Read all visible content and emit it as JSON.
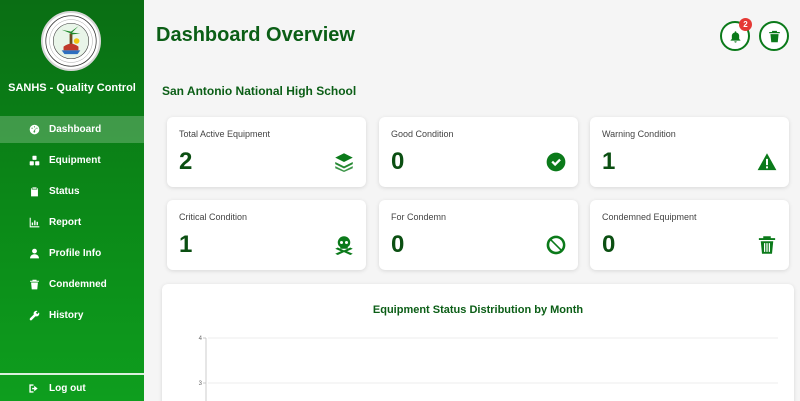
{
  "sidebar": {
    "logo": {
      "name": "sanhs-seal",
      "text": "SAN ANTONIO NATIONAL HIGH SCHOOL"
    },
    "brand": "SANHS - Quality Control",
    "items": [
      {
        "label": "Dashboard",
        "icon": "dashboard-icon",
        "active": true
      },
      {
        "label": "Equipment",
        "icon": "equipment-icon",
        "active": false
      },
      {
        "label": "Status",
        "icon": "clipboard-icon",
        "active": false
      },
      {
        "label": "Report",
        "icon": "chart-icon",
        "active": false
      },
      {
        "label": "Profile Info",
        "icon": "user-icon",
        "active": false
      },
      {
        "label": "Condemned",
        "icon": "trash-icon",
        "active": false
      },
      {
        "label": "History",
        "icon": "wrench-icon",
        "active": false
      }
    ],
    "logout_label": "Log out"
  },
  "header": {
    "title": "Dashboard Overview",
    "notification_count": "2"
  },
  "school_name": "San Antonio National High School",
  "cards": [
    {
      "label": "Total Active Equipment",
      "value": "2",
      "icon": "layers-icon"
    },
    {
      "label": "Good Condition",
      "value": "0",
      "icon": "check-circle-icon"
    },
    {
      "label": "Warning Condition",
      "value": "1",
      "icon": "warning-icon"
    },
    {
      "label": "Critical Condition",
      "value": "1",
      "icon": "skull-icon"
    },
    {
      "label": "For Condemn",
      "value": "0",
      "icon": "ban-icon"
    },
    {
      "label": "Condemned Equipment",
      "value": "0",
      "icon": "trash-icon"
    }
  ],
  "colors": {
    "primary": "#0b7a1a",
    "dark_text": "#0b4f12",
    "badge": "#e53935"
  },
  "chart_data": {
    "type": "bar",
    "title": "Equipment Status Distribution by Month",
    "y_ticks": [
      "4",
      "3"
    ],
    "grid": true
  }
}
